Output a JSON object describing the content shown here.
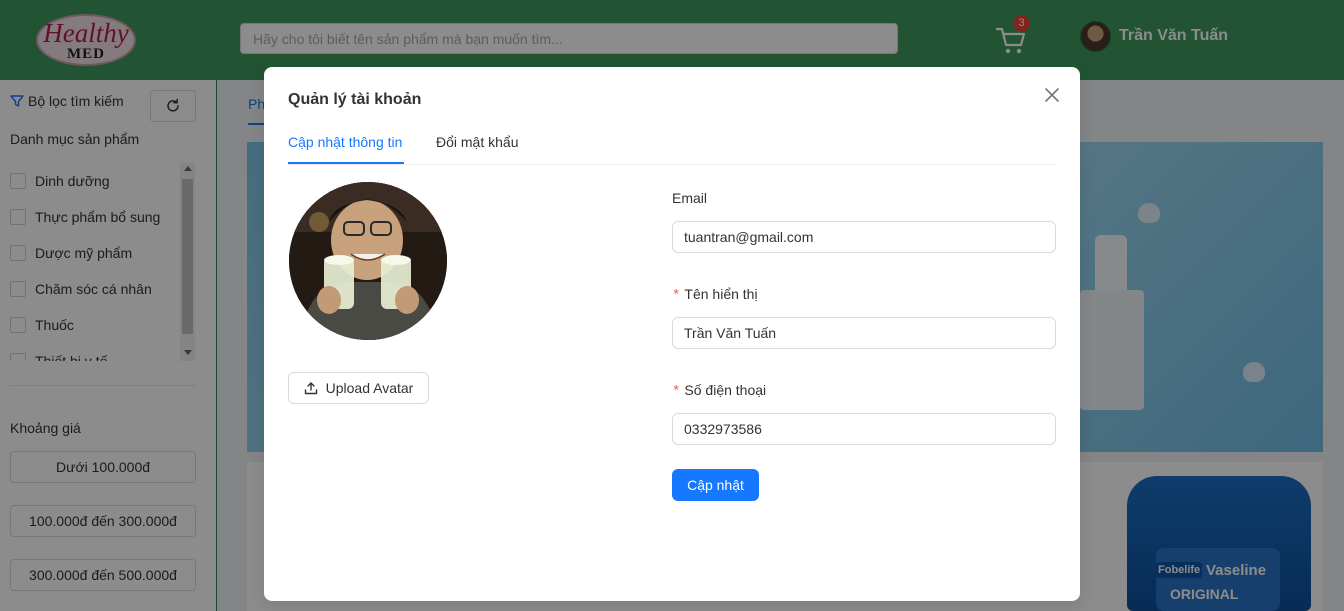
{
  "header": {
    "logo_line1": "Healthy",
    "logo_line2": "MED",
    "search_placeholder": "Hãy cho tôi biết tên sản phẩm mà bạn muốn tìm...",
    "cart_count": "3",
    "user_name": "Trần Văn Tuấn"
  },
  "sidebar": {
    "filter_title": "Bộ lọc tìm kiếm",
    "category_heading": "Danh mục sản phẩm",
    "categories": [
      {
        "label": "Dinh dưỡng"
      },
      {
        "label": "Thực phẩm bổ sung"
      },
      {
        "label": "Dược mỹ phẩm"
      },
      {
        "label": "Chăm sóc cá nhân"
      },
      {
        "label": "Thuốc"
      },
      {
        "label": "Thiết bị y tế"
      }
    ],
    "price_heading": "Khoảng giá",
    "price_ranges": [
      {
        "label": "Dưới 100.000đ"
      },
      {
        "label": "100.000đ đến 300.000đ"
      },
      {
        "label": "300.000đ đến 500.000đ"
      }
    ]
  },
  "main": {
    "tab_partial": "Ph",
    "product_label_brand": "Fobelife",
    "product_label_name": "Vaseline",
    "product_label_sub": "ORIGINAL"
  },
  "modal": {
    "title": "Quản lý tài khoản",
    "tabs": [
      {
        "label": "Cập nhật thông tin"
      },
      {
        "label": "Đổi mật khẩu"
      }
    ],
    "upload_label": "Upload Avatar",
    "email_label": "Email",
    "email_value": "tuantran@gmail.com",
    "name_label": "Tên hiển thị",
    "name_value": "Trần Văn Tuấn",
    "phone_label": "Số điện thoại",
    "phone_value": "0332973586",
    "required_mark": "*",
    "submit_label": "Cập nhật"
  },
  "colors": {
    "header_green": "#3e9a5f",
    "primary_blue": "#1677ff",
    "badge_red": "#e8423b"
  }
}
